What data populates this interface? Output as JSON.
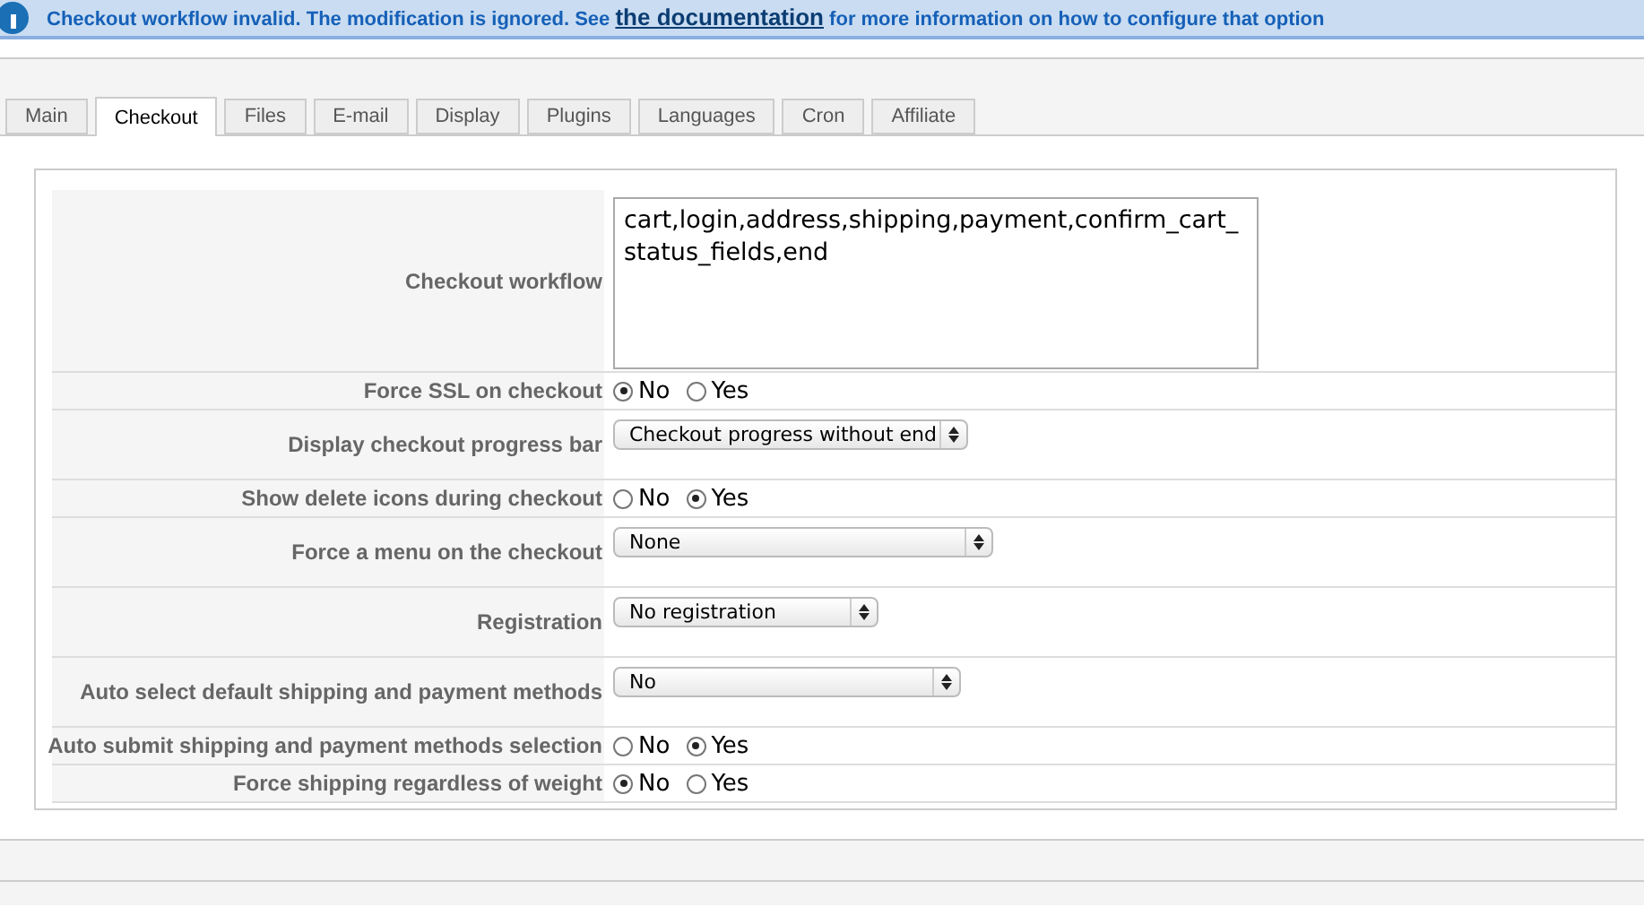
{
  "message": {
    "text": "Checkout workflow invalid. The modification is ignored. See ",
    "link": "the documentation",
    "after": " for more information on how to configure that option"
  },
  "tabs": [
    {
      "label": "Main",
      "selected": false
    },
    {
      "label": "Checkout",
      "selected": true
    },
    {
      "label": "Files",
      "selected": false
    },
    {
      "label": "E-mail",
      "selected": false
    },
    {
      "label": "Display",
      "selected": false
    },
    {
      "label": "Plugins",
      "selected": false
    },
    {
      "label": "Languages",
      "selected": false
    },
    {
      "label": "Cron",
      "selected": false
    },
    {
      "label": "Affiliate",
      "selected": false
    }
  ],
  "rows": [
    {
      "kind": "textarea",
      "label": "Checkout workflow",
      "value": "cart,login,address,shipping,payment,confirm_cart_status_fields,end"
    },
    {
      "kind": "radio",
      "label": "Force SSL on checkout",
      "options": [
        {
          "label": "No",
          "selected": true
        },
        {
          "label": "Yes",
          "selected": false
        }
      ]
    },
    {
      "kind": "select",
      "label": "Display checkout progress bar",
      "value": "Checkout progress without end"
    },
    {
      "kind": "radio",
      "label": "Show delete icons during checkout",
      "options": [
        {
          "label": "No",
          "selected": false
        },
        {
          "label": "Yes",
          "selected": true
        }
      ]
    },
    {
      "kind": "select",
      "label": "Force a menu on the checkout",
      "value": "None"
    },
    {
      "kind": "select",
      "label": "Registration",
      "value": "No registration"
    },
    {
      "kind": "select",
      "label": "Auto select default shipping and payment methods",
      "value": "No"
    },
    {
      "kind": "radio",
      "label": "Auto submit shipping and payment methods selection",
      "options": [
        {
          "label": "No",
          "selected": false
        },
        {
          "label": "Yes",
          "selected": true
        }
      ]
    },
    {
      "kind": "radio",
      "label": "Force shipping regardless of weight",
      "options": [
        {
          "label": "No",
          "selected": true
        },
        {
          "label": "Yes",
          "selected": false
        }
      ]
    }
  ]
}
